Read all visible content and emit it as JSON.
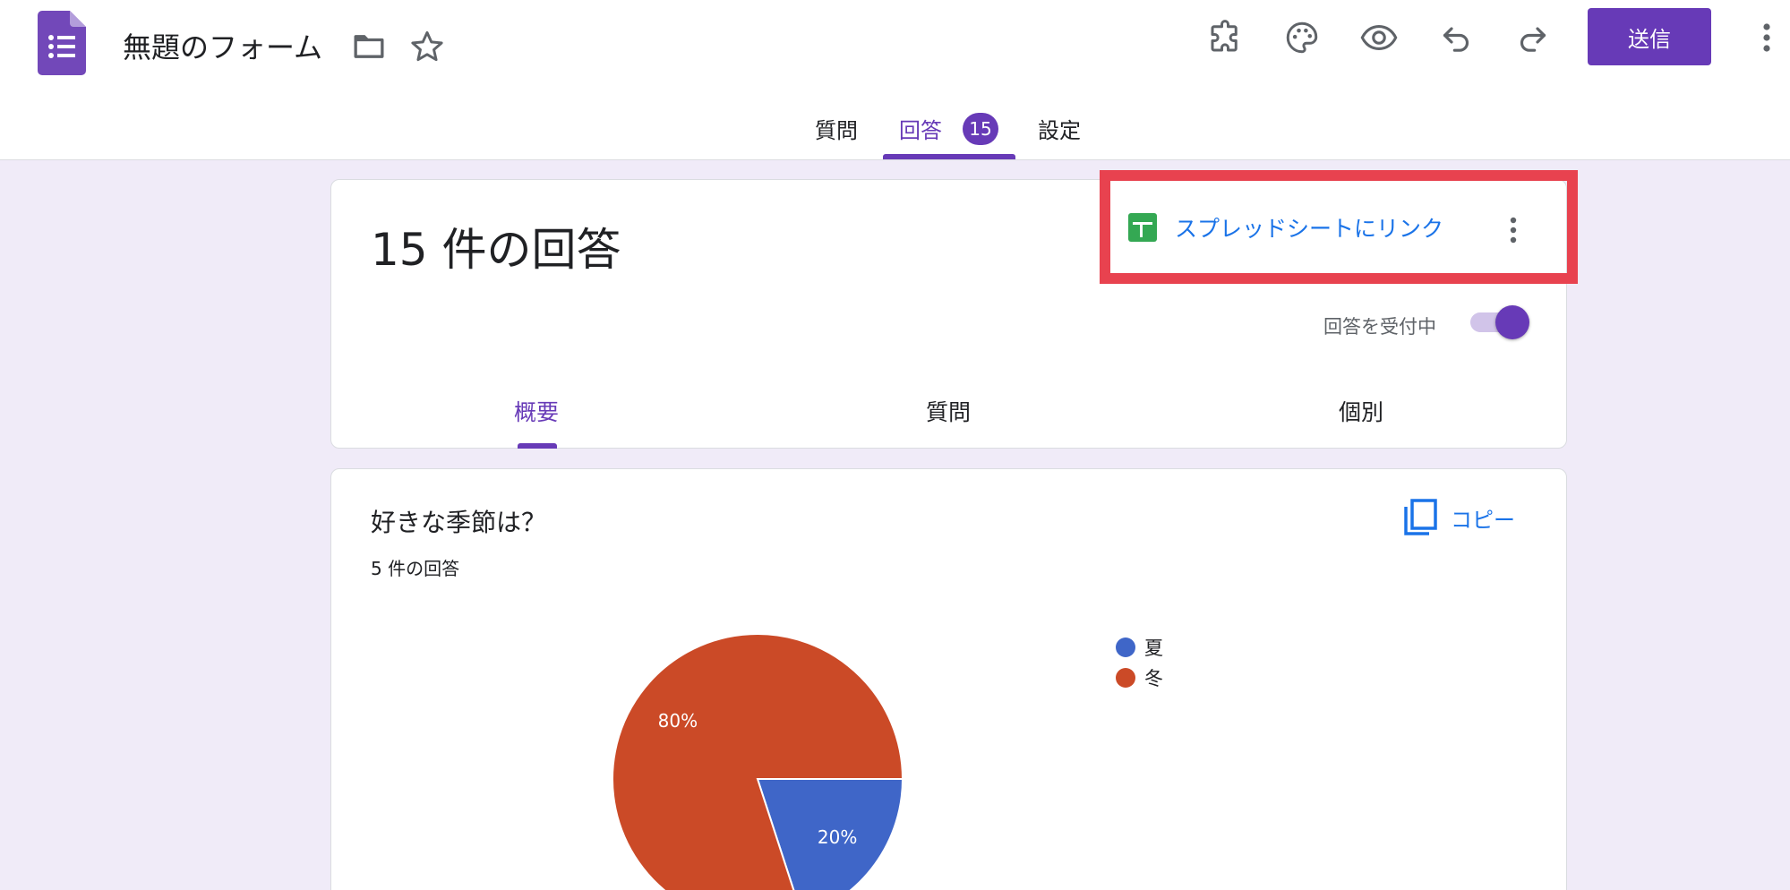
{
  "header": {
    "title": "無題のフォーム",
    "send_label": "送信"
  },
  "main_tabs": {
    "questions": "質問",
    "responses": "回答",
    "responses_badge": "15",
    "settings": "設定"
  },
  "summary": {
    "response_count": "15 件の回答",
    "sheet_link_label": "スプレッドシートにリンク",
    "accepting_label": "回答を受付中",
    "accepting": true,
    "tabs": {
      "summary": "概要",
      "question": "質問",
      "individual": "個別"
    }
  },
  "question": {
    "title": "好きな季節は？",
    "count": "5 件の回答",
    "copy_label": "コピー"
  },
  "colors": {
    "accent": "#673ab7",
    "link": "#1a73e8",
    "highlight": "#e8424f",
    "sheets_green": "#34a853"
  },
  "chart_data": {
    "type": "pie",
    "categories": [
      "夏",
      "冬"
    ],
    "values": [
      20,
      80
    ],
    "labels": [
      "20%",
      "80%"
    ],
    "colors": [
      "#3f66c8",
      "#cb4a27"
    ],
    "legend": "right"
  }
}
